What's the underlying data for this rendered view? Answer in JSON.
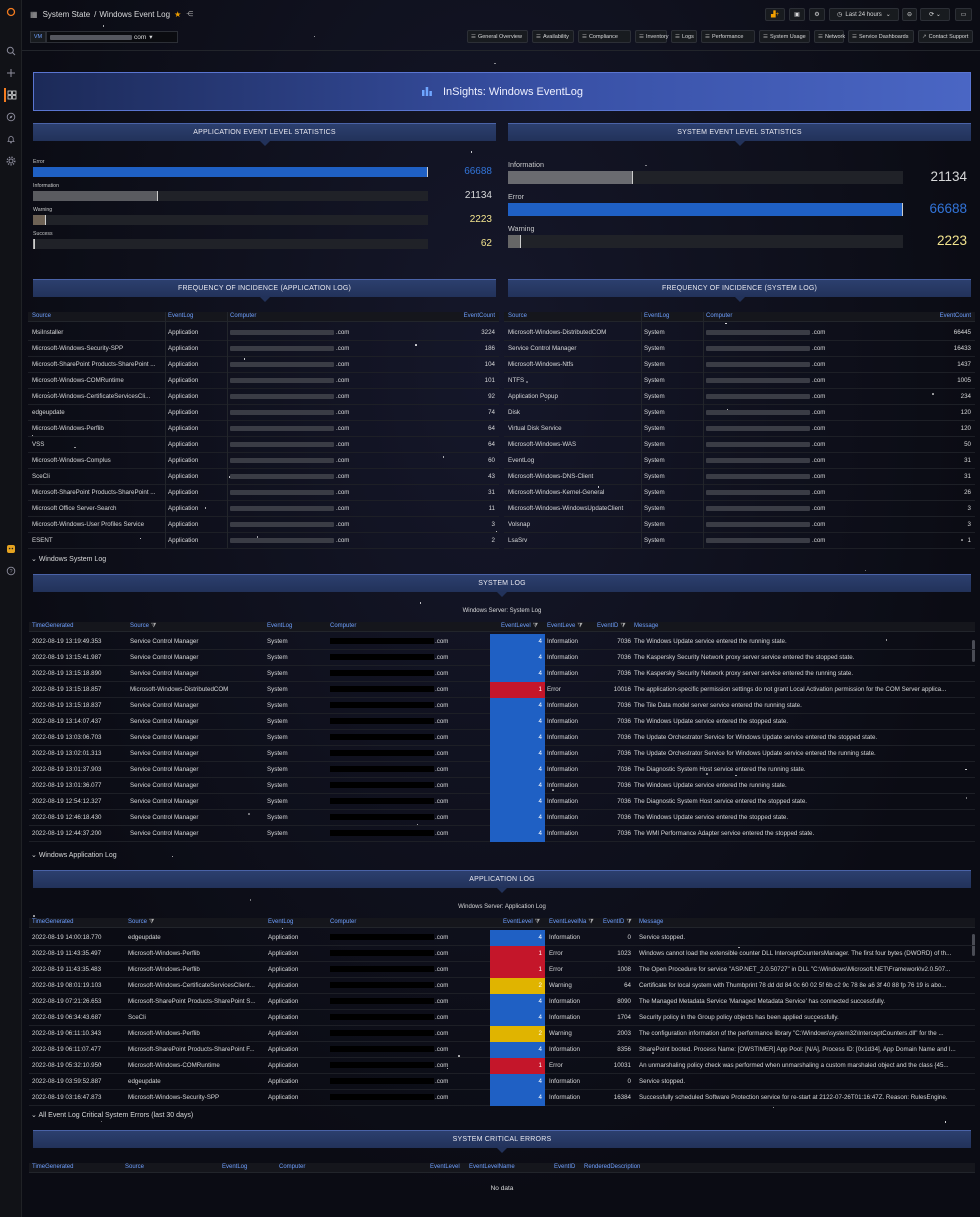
{
  "breadcrumb": {
    "folder": "System State",
    "separator": "/",
    "dashboard": "Windows Event Log"
  },
  "toolbar": {
    "time_range": "Last 24 hours"
  },
  "variables": {
    "vm_label": "VM",
    "vm_value": "com"
  },
  "links": [
    "General Overview",
    "Availability",
    "Compliance",
    "Inventory",
    "Logs",
    "Performance",
    "System Usage",
    "Network",
    "Service Dashboards",
    "Contact Support"
  ],
  "banner": {
    "title": "InSights: Windows EventLog"
  },
  "app_stats": {
    "title": "APPLICATION EVENT LEVEL STATISTICS",
    "items": [
      {
        "label": "Error",
        "value": "66688",
        "fraction": 1.0,
        "color": "#1f60c4",
        "valcolor": "#3274d9"
      },
      {
        "label": "Information",
        "value": "21134",
        "fraction": 0.317,
        "color": "#5a5b60",
        "valcolor": "#d8d9da"
      },
      {
        "label": "Warning",
        "value": "2223",
        "fraction": 0.033,
        "color": "#6e6255",
        "valcolor": "#f2e38e"
      },
      {
        "label": "Success",
        "value": "62",
        "fraction": 0.001,
        "color": "#aaaaaa",
        "valcolor": "#f2e38e"
      }
    ]
  },
  "sys_stats": {
    "title": "SYSTEM EVENT LEVEL STATISTICS",
    "items": [
      {
        "label": "Information",
        "value": "21134",
        "fraction": 0.317,
        "color": "#6a6b70",
        "valcolor": "#d8d9da"
      },
      {
        "label": "Error",
        "value": "66688",
        "fraction": 1.0,
        "color": "#1f60c4",
        "valcolor": "#3274d9"
      },
      {
        "label": "Warning",
        "value": "2223",
        "fraction": 0.033,
        "color": "#666",
        "valcolor": "#f2e38e"
      }
    ]
  },
  "freq_app": {
    "title": "FREQUENCY OF INCIDENCE (APPLICATION LOG)",
    "columns": [
      "Source",
      "EventLog",
      "Computer",
      "EventCount"
    ],
    "rows": [
      [
        "MsiInstaller",
        "Application",
        ".com",
        "3224"
      ],
      [
        "Microsoft-Windows-Security-SPP",
        "Application",
        ".com",
        "186"
      ],
      [
        "Microsoft-SharePoint Products-SharePoint ...",
        "Application",
        ".com",
        "104"
      ],
      [
        "Microsoft-Windows-COMRuntime",
        "Application",
        ".com",
        "101"
      ],
      [
        "Microsoft-Windows-CertificateServicesCli...",
        "Application",
        ".com",
        "92"
      ],
      [
        "edgeupdate",
        "Application",
        ".com",
        "74"
      ],
      [
        "Microsoft-Windows-Perflib",
        "Application",
        ".com",
        "64"
      ],
      [
        "VSS",
        "Application",
        ".com",
        "64"
      ],
      [
        "Microsoft-Windows-Complus",
        "Application",
        ".com",
        "60"
      ],
      [
        "SceCli",
        "Application",
        ".com",
        "43"
      ],
      [
        "Microsoft-SharePoint Products-SharePoint ...",
        "Application",
        ".com",
        "31"
      ],
      [
        "Microsoft Office Server-Search",
        "Application",
        ".com",
        "11"
      ],
      [
        "Microsoft-Windows-User Profiles Service",
        "Application",
        ".com",
        "3"
      ],
      [
        "ESENT",
        "Application",
        ".com",
        "2"
      ]
    ]
  },
  "freq_sys": {
    "title": "FREQUENCY OF INCIDENCE (SYSTEM LOG)",
    "columns": [
      "Source",
      "EventLog",
      "Computer",
      "EventCount"
    ],
    "rows": [
      [
        "Microsoft-Windows-DistributedCOM",
        "System",
        ".com",
        "66445"
      ],
      [
        "Service Control Manager",
        "System",
        ".com",
        "16433"
      ],
      [
        "Microsoft-Windows-Ntfs",
        "System",
        ".com",
        "1437"
      ],
      [
        "NTFS",
        "System",
        ".com",
        "1005"
      ],
      [
        "Application Popup",
        "System",
        ".com",
        "234"
      ],
      [
        "Disk",
        "System",
        ".com",
        "120"
      ],
      [
        "Virtual Disk Service",
        "System",
        ".com",
        "120"
      ],
      [
        "Microsoft-Windows-WAS",
        "System",
        ".com",
        "50"
      ],
      [
        "EventLog",
        "System",
        ".com",
        "31"
      ],
      [
        "Microsoft-Windows-DNS-Client",
        "System",
        ".com",
        "31"
      ],
      [
        "Microsoft-Windows-Kernel-General",
        "System",
        ".com",
        "26"
      ],
      [
        "Microsoft-Windows-WindowsUpdateClient",
        "System",
        ".com",
        "3"
      ],
      [
        "Volsnap",
        "System",
        ".com",
        "3"
      ],
      [
        "LsaSrv",
        "System",
        ".com",
        "1"
      ]
    ]
  },
  "sys_section": {
    "label": "Windows System Log",
    "panel": "SYSTEM LOG",
    "subtitle": "Windows Server: System Log",
    "columns": [
      "TimeGenerated",
      "Source",
      "EventLog",
      "Computer",
      "EventLevel",
      "EventLeve",
      "EventID",
      "Message"
    ],
    "rows": [
      [
        "2022-08-19 13:19:49.353",
        "Service Control Manager",
        "System",
        ".com",
        "4",
        "Information",
        "7036",
        "The Windows Update service entered the running state."
      ],
      [
        "2022-08-19 13:15:41.987",
        "Service Control Manager",
        "System",
        ".com",
        "4",
        "Information",
        "7036",
        "The Kaspersky Security Network proxy server service entered the stopped state."
      ],
      [
        "2022-08-19 13:15:18.890",
        "Service Control Manager",
        "System",
        ".com",
        "4",
        "Information",
        "7036",
        "The Kaspersky Security Network proxy server service entered the running state."
      ],
      [
        "2022-08-19 13:15:18.857",
        "Microsoft-Windows-DistributedCOM",
        "System",
        ".com",
        "1",
        "Error",
        "10016",
        "The application-specific permission settings do not grant Local Activation permission for the COM Server applica..."
      ],
      [
        "2022-08-19 13:15:18.837",
        "Service Control Manager",
        "System",
        ".com",
        "4",
        "Information",
        "7036",
        "The Tile Data model server service entered the running state."
      ],
      [
        "2022-08-19 13:14:07.437",
        "Service Control Manager",
        "System",
        ".com",
        "4",
        "Information",
        "7036",
        "The Windows Update service entered the stopped state."
      ],
      [
        "2022-08-19 13:03:06.703",
        "Service Control Manager",
        "System",
        ".com",
        "4",
        "Information",
        "7036",
        "The Update Orchestrator Service for Windows Update service entered the stopped state."
      ],
      [
        "2022-08-19 13:02:01.313",
        "Service Control Manager",
        "System",
        ".com",
        "4",
        "Information",
        "7036",
        "The Update Orchestrator Service for Windows Update service entered the running state."
      ],
      [
        "2022-08-19 13:01:37.903",
        "Service Control Manager",
        "System",
        ".com",
        "4",
        "Information",
        "7036",
        "The Diagnostic System Host service entered the running state."
      ],
      [
        "2022-08-19 13:01:36.077",
        "Service Control Manager",
        "System",
        ".com",
        "4",
        "Information",
        "7036",
        "The Windows Update service entered the running state."
      ],
      [
        "2022-08-19 12:54:12.327",
        "Service Control Manager",
        "System",
        ".com",
        "4",
        "Information",
        "7036",
        "The Diagnostic System Host service entered the stopped state."
      ],
      [
        "2022-08-19 12:46:18.430",
        "Service Control Manager",
        "System",
        ".com",
        "4",
        "Information",
        "7036",
        "The Windows Update service entered the stopped state."
      ],
      [
        "2022-08-19 12:44:37.200",
        "Service Control Manager",
        "System",
        ".com",
        "4",
        "Information",
        "7036",
        "The WMI Performance Adapter service entered the stopped state."
      ]
    ]
  },
  "app_section": {
    "label": "Windows Application Log",
    "panel": "APPLICATION LOG",
    "subtitle": "Windows Server: Application Log",
    "columns": [
      "TimeGenerated",
      "Source",
      "EventLog",
      "Computer",
      "EventLevel",
      "EventLevelNa",
      "EventID",
      "Message"
    ],
    "rows": [
      [
        "2022-08-19 14:00:18.770",
        "edgeupdate",
        "Application",
        ".com",
        "4",
        "Information",
        "0",
        "Service stopped."
      ],
      [
        "2022-08-19 11:43:35.497",
        "Microsoft-Windows-Perflib",
        "Application",
        ".com",
        "1",
        "Error",
        "1023",
        "Windows cannot load the extensible counter DLL InterceptCountersManager. The first four bytes (DWORD) of th..."
      ],
      [
        "2022-08-19 11:43:35.483",
        "Microsoft-Windows-Perflib",
        "Application",
        ".com",
        "1",
        "Error",
        "1008",
        "The Open Procedure for service \"ASP.NET_2.0.50727\" in DLL \"C:\\Windows\\Microsoft.NET\\Framework\\v2.0.507..."
      ],
      [
        "2022-08-19 08:01:19.103",
        "Microsoft-Windows-CertificateServicesClient...",
        "Application",
        ".com",
        "2",
        "Warning",
        "64",
        "Certificate for local system with Thumbprint 78 dd dd 84 0c 60 02 5f 6b c2 9c 78 8e a6 3f 40 88 fp 76 19 is abo..."
      ],
      [
        "2022-08-19 07:21:26.653",
        "Microsoft-SharePoint Products-SharePoint S...",
        "Application",
        ".com",
        "4",
        "Information",
        "8090",
        "The Managed Metadata Service 'Managed Metadata Service' has connected successfully."
      ],
      [
        "2022-08-19 06:34:43.687",
        "SceCli",
        "Application",
        ".com",
        "4",
        "Information",
        "1704",
        "Security policy in the Group policy objects has been applied successfully."
      ],
      [
        "2022-08-19 06:11:10.343",
        "Microsoft-Windows-Perflib",
        "Application",
        ".com",
        "2",
        "Warning",
        "2003",
        "The configuration information of the performance library \"C:\\Windows\\system32\\InterceptCounters.dll\" for the ..."
      ],
      [
        "2022-08-19 06:11:07.477",
        "Microsoft-SharePoint Products-SharePoint F...",
        "Application",
        ".com",
        "4",
        "Information",
        "8356",
        "SharePoint booted. Process Name: [OWSTIMER] App Pool: [N/A], Process ID: [0x1d34], App Domain Name and I..."
      ],
      [
        "2022-08-19 05:32:10.950",
        "Microsoft-Windows-COMRuntime",
        "Application",
        ".com",
        "1",
        "Error",
        "10031",
        "An unmarshaling policy check was performed when unmarshaling a custom marshaled object and the class {45..."
      ],
      [
        "2022-08-19 03:59:52.887",
        "edgeupdate",
        "Application",
        ".com",
        "4",
        "Information",
        "0",
        "Service stopped."
      ],
      [
        "2022-08-19 03:16:47.873",
        "Microsoft-Windows-Security-SPP",
        "Application",
        ".com",
        "4",
        "Information",
        "16384",
        "Successfully scheduled Software Protection service for re-start at 2122-07-26T01:16:47Z. Reason: RulesEngine."
      ]
    ]
  },
  "crit_section": {
    "label": "All Event Log Critical System Errors (last 30 days)",
    "panel": "SYSTEM CRITICAL ERRORS",
    "columns": [
      "TimeGenerated",
      "Source",
      "EventLog",
      "Computer",
      "EventLevel",
      "EventLevelName",
      "EventID",
      "RenderedDescription"
    ],
    "empty": "No data"
  },
  "level_colors": {
    "1": "#c4162a",
    "2": "#e0b400",
    "4": "#1f60c4"
  }
}
